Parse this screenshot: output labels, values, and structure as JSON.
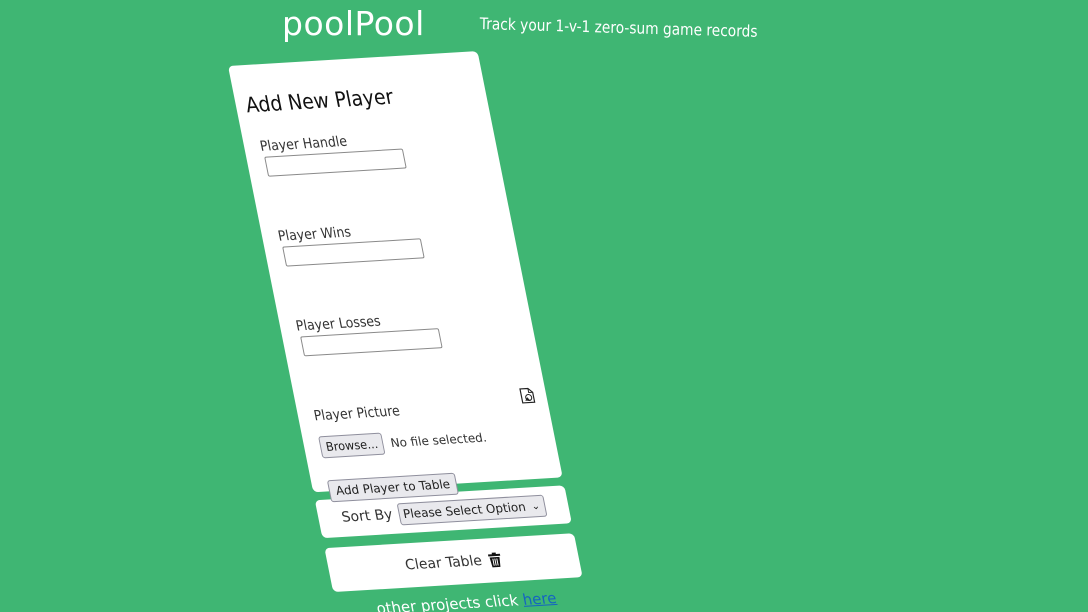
{
  "header": {
    "brand": "poolPool",
    "tagline": "Track your 1-v-1 zero-sum game records"
  },
  "form": {
    "title": "Add New Player",
    "handle_label": "Player Handle",
    "handle_value": "",
    "wins_label": "Player Wins",
    "wins_value": "",
    "losses_label": "Player Losses",
    "losses_value": "",
    "picture_label": "Player Picture",
    "browse_label": "Browse...",
    "file_status": "No file selected.",
    "submit_label": "Add Player to Table"
  },
  "sort": {
    "label": "Sort By",
    "selected": "Please Select Option"
  },
  "clear": {
    "label": "Clear Table"
  },
  "footer": {
    "text": "other projects click",
    "link": "here"
  },
  "colors": {
    "background": "#3fb673",
    "card": "#ffffff",
    "link": "#1565c0"
  },
  "icons": {
    "picture": "image-file-icon",
    "trash": "trash-icon",
    "select": "chevron-down-icon"
  }
}
